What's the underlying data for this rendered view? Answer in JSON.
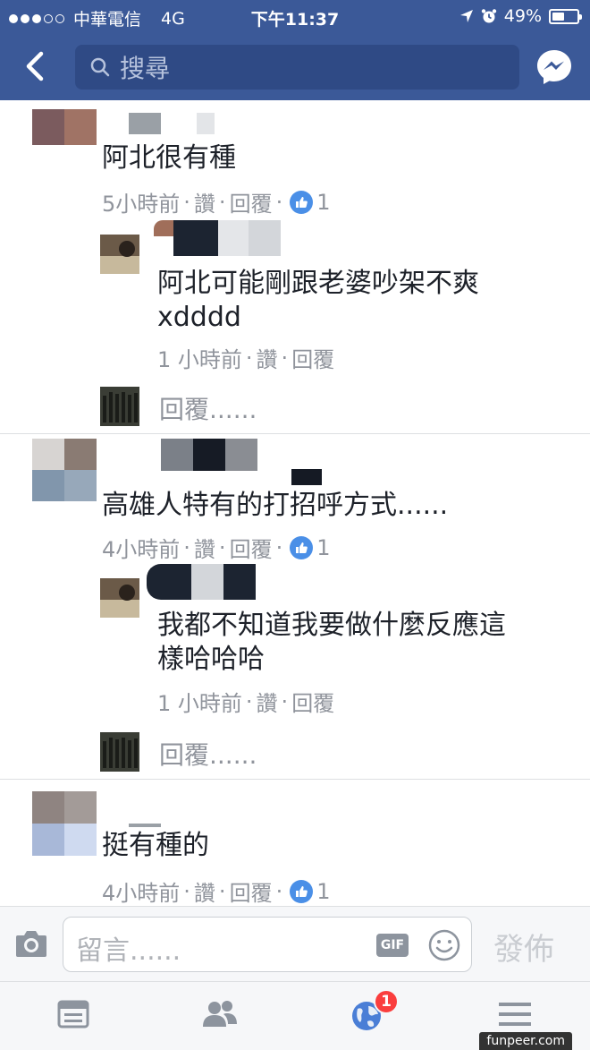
{
  "status_bar": {
    "carrier": "中華電信",
    "network": "4G",
    "time": "下午11:37",
    "battery": "49%",
    "battery_level": 0.49
  },
  "header": {
    "search_placeholder": "搜尋"
  },
  "comments": [
    {
      "text": "阿北很有種",
      "time": "5小時前",
      "like": "讚",
      "reply": "回覆",
      "like_count": "1",
      "reply_item": {
        "text_line1": "阿北可能剛跟老婆吵架不爽",
        "text_line2": "xdddd",
        "time": "1 小時前",
        "like": "讚",
        "reply": "回覆"
      },
      "reply_prompt": "回覆......"
    },
    {
      "text": "高雄人特有的打招呼方式......",
      "time": "4小時前",
      "like": "讚",
      "reply": "回覆",
      "like_count": "1",
      "reply_item": {
        "text_line1": "我都不知道我要做什麼反應這",
        "text_line2": "樣哈哈哈",
        "time": "1 小時前",
        "like": "讚",
        "reply": "回覆"
      },
      "reply_prompt": "回覆......"
    },
    {
      "text": "挺有種的",
      "time": "4小時前",
      "like": "讚",
      "reply": "回覆",
      "like_count": "1"
    }
  ],
  "composer": {
    "placeholder": "留言......",
    "gif_label": "GIF",
    "post_label": "發佈"
  },
  "tabbar": {
    "notifications_badge": "1"
  },
  "watermark": "funpeer.com",
  "colors": {
    "header": "#3b5998",
    "like_blue": "#4a8fe7",
    "badge_red": "#fa3e3e",
    "meta_gray": "#90949c"
  }
}
